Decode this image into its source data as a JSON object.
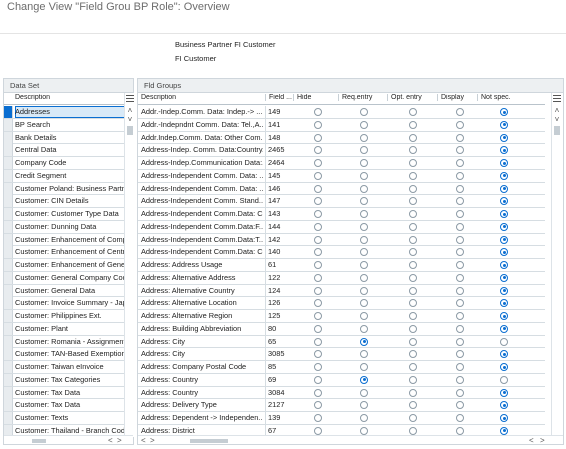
{
  "window": {
    "title": "Change View \"Field Grou BP Role\": Overview"
  },
  "header": {
    "role": "Business Partner FI Customer",
    "role_description": "FI Customer"
  },
  "left_panel": {
    "title": "Data Set",
    "column": "Description",
    "selected_index": 0,
    "rows": [
      "Addresses",
      "BP Search",
      "Bank Details",
      "Central Data",
      "Company Code",
      "Credit Segment",
      "Customer Poland: Business Partner",
      "Customer: CIN Details",
      "Customer: Customer Type Data",
      "Customer: Dunning Data",
      "Customer: Enhancement of Company Code",
      "Customer: Enhancement of Central Data",
      "Customer: Enhancement of General Data",
      "Customer: General Company Code",
      "Customer: General Data",
      "Customer: Invoice Summary - Japan",
      "Customer: Philippines Ext.",
      "Customer: Plant",
      "Customer: Romania - Assignment",
      "Customer: TAN-Based Exemption",
      "Customer: Taiwan eInvoice",
      "Customer: Tax Categories",
      "Customer: Tax Data",
      "Customer: Tax Data",
      "Customer: Texts",
      "Customer: Thailand - Branch Code"
    ]
  },
  "right_panel": {
    "title": "Fld Groups",
    "columns": [
      "Description",
      "Field ...",
      "Hide",
      "Req.entry",
      "Opt. entry",
      "Display",
      "Not spec."
    ],
    "rows": [
      {
        "desc": "Addr.-Indep.Comm. Data: Indep.-> ...",
        "field": "149",
        "sel": 4
      },
      {
        "desc": "Addr.-Indepndnt Comm. Data: Tel.,A...",
        "field": "141",
        "sel": 4
      },
      {
        "desc": "Addr.Indep.Comm. Data: Other Com...",
        "field": "148",
        "sel": 4
      },
      {
        "desc": "Address-Indep. Comm. Data:Country...",
        "field": "2465",
        "sel": 4
      },
      {
        "desc": "Address-Indep.Communication Data:...",
        "field": "2464",
        "sel": 4
      },
      {
        "desc": "Address-Independent Comm. Data: ...",
        "field": "145",
        "sel": 4
      },
      {
        "desc": "Address-Independent Comm. Data: ...",
        "field": "146",
        "sel": 4
      },
      {
        "desc": "Address-Independent Comm. Stand...",
        "field": "147",
        "sel": 4
      },
      {
        "desc": "Address-Independent Comm.Data: C...",
        "field": "143",
        "sel": 4
      },
      {
        "desc": "Address-Independent Comm.Data:F...",
        "field": "144",
        "sel": 4
      },
      {
        "desc": "Address-Independent Comm.Data:T...",
        "field": "142",
        "sel": 4
      },
      {
        "desc": "Address-Independent Comm.Data: Cou...",
        "field": "140",
        "sel": 4
      },
      {
        "desc": "Address: Address Usage",
        "field": "61",
        "sel": 4
      },
      {
        "desc": "Address: Alternative Address",
        "field": "122",
        "sel": 4
      },
      {
        "desc": "Address: Alternative Country",
        "field": "124",
        "sel": 4
      },
      {
        "desc": "Address: Alternative Location",
        "field": "126",
        "sel": 4
      },
      {
        "desc": "Address: Alternative Region",
        "field": "125",
        "sel": 4
      },
      {
        "desc": "Address: Building Abbreviation",
        "field": "80",
        "sel": 4
      },
      {
        "desc": "Address: City",
        "field": "65",
        "sel": 1
      },
      {
        "desc": "Address: City",
        "field": "3085",
        "sel": 4
      },
      {
        "desc": "Address: Company Postal Code",
        "field": "85",
        "sel": 4
      },
      {
        "desc": "Address: Country",
        "field": "69",
        "sel": 1
      },
      {
        "desc": "Address: Country",
        "field": "3084",
        "sel": 4
      },
      {
        "desc": "Address: Delivery Type",
        "field": "2127",
        "sel": 4
      },
      {
        "desc": "Address: Dependent -> Independen...",
        "field": "139",
        "sel": 4
      },
      {
        "desc": "Address: District",
        "field": "67",
        "sel": 4
      }
    ]
  },
  "icons": {
    "left_settings": "table-settings-icon",
    "right_settings": "table-settings-icon",
    "scroll_up": "chevron-up-icon",
    "scroll_down": "chevron-down-icon",
    "scroll_left": "chevron-left-icon",
    "scroll_right": "chevron-right-icon"
  },
  "colors": {
    "accent": "#0a6ed1",
    "selected_row": "#d8e9f7",
    "panel_header": "#edf0f2"
  }
}
